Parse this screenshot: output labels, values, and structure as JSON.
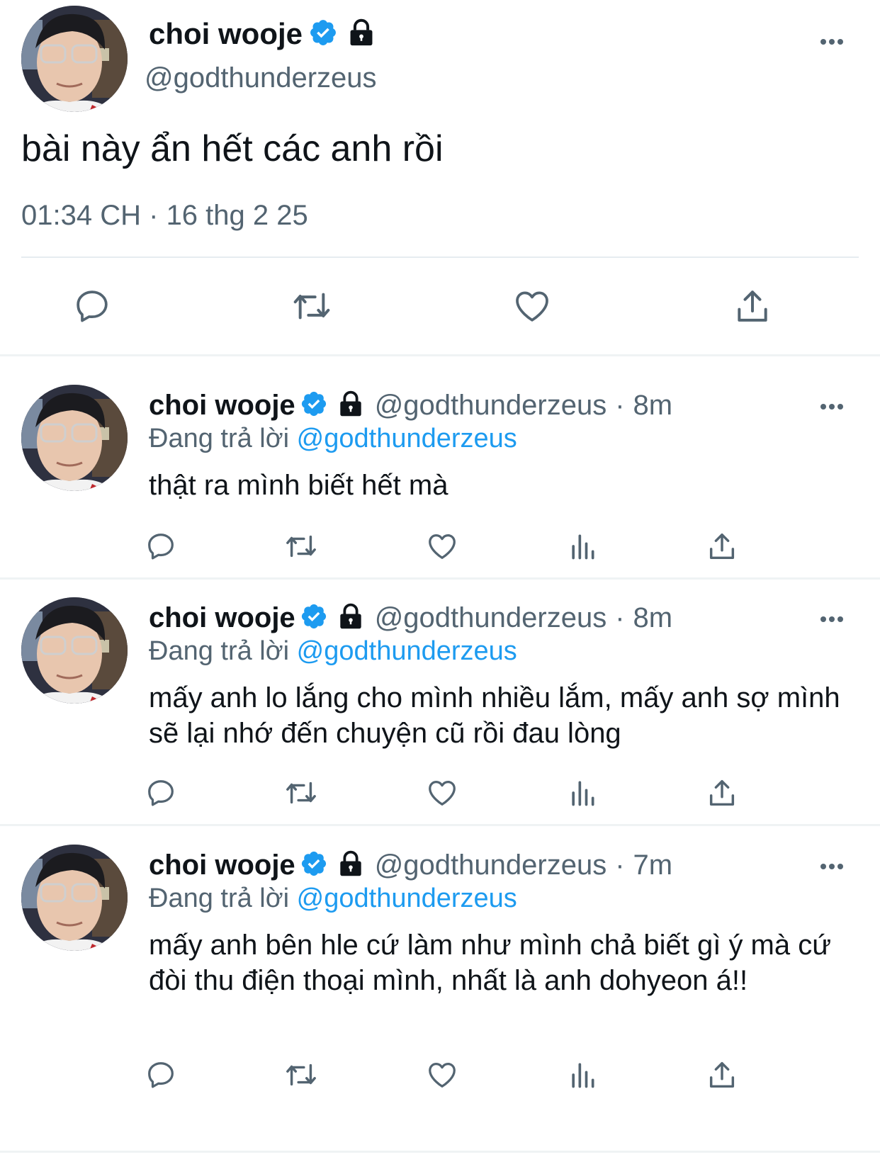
{
  "main_tweet": {
    "display_name": "choi wooje",
    "handle": "@godthunderzeus",
    "text": "bài này ẩn hết các anh rồi",
    "time": "01:34 CH",
    "separator": "·",
    "date": "16 thg 2 25"
  },
  "replies": [
    {
      "display_name": "choi wooje",
      "handle": "@godthunderzeus",
      "separator": "·",
      "age": "8m",
      "replying_prefix": "Đang trả lời",
      "replying_to": "@godthunderzeus",
      "text": "thật ra mình biết hết mà"
    },
    {
      "display_name": "choi wooje",
      "handle": "@godthunderzeus",
      "separator": "·",
      "age": "8m",
      "replying_prefix": "Đang trả lời",
      "replying_to": "@godthunderzeus",
      "text": "mấy anh lo lắng cho mình nhiều lắm, mấy anh sợ mình sẽ lại nhớ đến chuyện cũ rồi đau lòng"
    },
    {
      "display_name": "choi wooje",
      "handle": "@godthunderzeus",
      "separator": "·",
      "age": "7m",
      "replying_prefix": "Đang trả lời",
      "replying_to": "@godthunderzeus",
      "text": "mấy anh bên hle cứ làm như mình chả biết gì ý mà cứ đòi thu điện thoại mình, nhất là anh dohyeon á!!"
    }
  ],
  "colors": {
    "accent": "#1d9bf0",
    "text": "#0f1419",
    "muted": "#536471",
    "divider": "#eff3f4"
  },
  "icons": [
    "verified-badge-icon",
    "lock-icon",
    "more-icon",
    "reply-icon",
    "retweet-icon",
    "like-icon",
    "views-icon",
    "share-icon"
  ]
}
